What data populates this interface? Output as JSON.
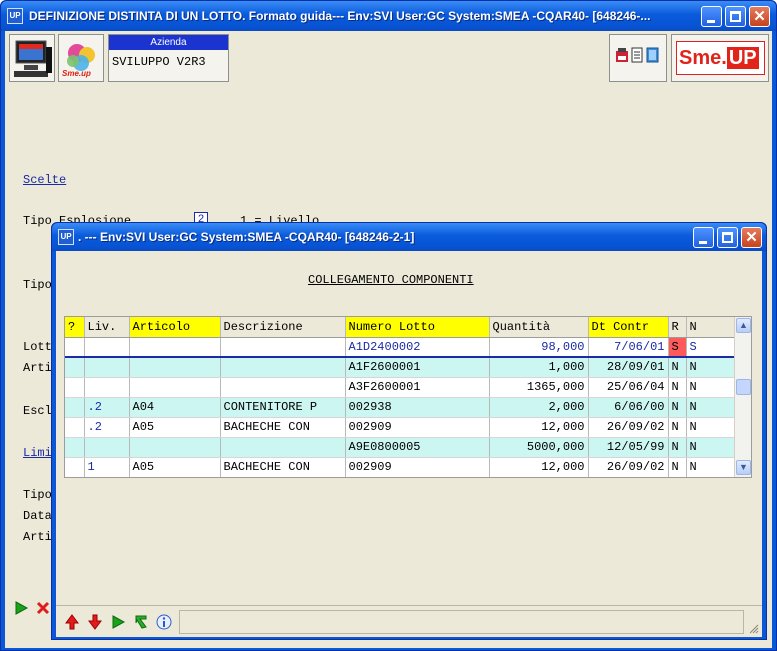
{
  "main_window": {
    "title": "DEFINIZIONE DISTINTA DI UN LOTTO.  Formato guida--- Env:SVI User:GC System:SMEA -CQAR40- [648246-...",
    "title_icon": "UP",
    "azienda_label": "Azienda",
    "azienda_value": "SVILUPPO V2R3",
    "logo_brand": "Sme.",
    "logo_suffix": "UP",
    "smeup_small": "Sme.up"
  },
  "background_form": {
    "scelte": "Scelte",
    "tipo_esplosione": "Tipo Esplosione",
    "tipo_esplosione_value": "2",
    "tipo_esplosione_hint": "1 = Livello",
    "tipo": "Tipo",
    "lotto": "Lott",
    "articolo": "Arti",
    "escl": "Escl",
    "limiti": "Limi",
    "tipo2": "Tipo",
    "data": "Data",
    "articolo2": "Arti"
  },
  "popup": {
    "title": ". --- Env:SVI User:GC System:SMEA -CQAR40- [648246-2-1]",
    "title_icon": "UP",
    "section_title": "COLLEGAMENTO COMPONENTI"
  },
  "grid": {
    "headers": [
      "?",
      "Liv.",
      "Articolo",
      "Descrizione",
      "Numero Lotto",
      "Quantità",
      "Dt Contr",
      "R",
      "N"
    ],
    "rows": [
      {
        "q": "",
        "liv": "",
        "art": "",
        "desc": "",
        "lotto": "A1D2400002",
        "qty": "98,000",
        "dt": "7/06/01",
        "r": "S",
        "n": "S"
      },
      {
        "q": "",
        "liv": "",
        "art": "",
        "desc": "",
        "lotto": "A1F2600001",
        "qty": "1,000",
        "dt": "28/09/01",
        "r": "N",
        "n": "N"
      },
      {
        "q": "",
        "liv": "",
        "art": "",
        "desc": "",
        "lotto": "A3F2600001",
        "qty": "1365,000",
        "dt": "25/06/04",
        "r": "N",
        "n": "N"
      },
      {
        "q": "",
        "liv": ".2",
        "art": "A04",
        "desc": "CONTENITORE P",
        "lotto": "002938",
        "qty": "2,000",
        "dt": "6/06/00",
        "r": "N",
        "n": "N"
      },
      {
        "q": "",
        "liv": ".2",
        "art": "A05",
        "desc": "BACHECHE CON",
        "lotto": "002909",
        "qty": "12,000",
        "dt": "26/09/02",
        "r": "N",
        "n": "N"
      },
      {
        "q": "",
        "liv": "",
        "art": "",
        "desc": "",
        "lotto": "A9E0800005",
        "qty": "5000,000",
        "dt": "12/05/99",
        "r": "N",
        "n": "N"
      },
      {
        "q": "",
        "liv": "1",
        "art": "A05",
        "desc": "BACHECHE CON",
        "lotto": "002909",
        "qty": "12,000",
        "dt": "26/09/02",
        "r": "N",
        "n": "N"
      }
    ]
  },
  "colors": {
    "xp_blue": "#0a57d8",
    "header_yellow": "#ffff00",
    "row_cyan": "#ccf6f2",
    "flag_red": "#ff5a5a",
    "link_blue": "#1b2aa6"
  },
  "icons": {
    "titlebar": [
      "minimize-icon",
      "maximize-icon",
      "close-icon"
    ],
    "main_bottom": [
      "confirm-arrow-icon",
      "cancel-x-icon"
    ],
    "popup_bottom": [
      "arrow-up-red-icon",
      "arrow-down-red-icon",
      "play-green-icon",
      "refresh-green-icon",
      "info-icon"
    ]
  }
}
